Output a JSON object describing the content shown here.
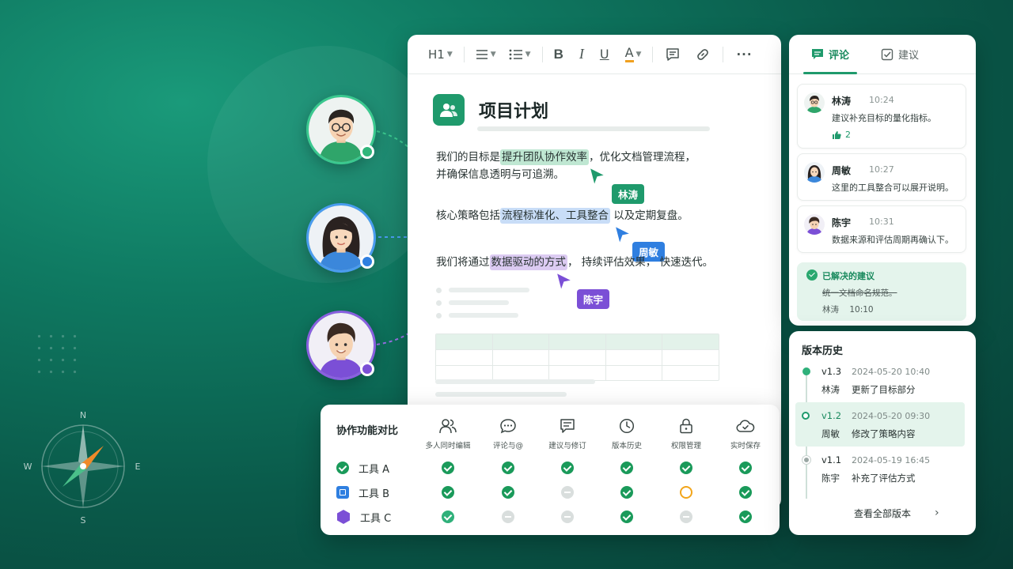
{
  "editor": {
    "toolbar": {
      "heading": "H1",
      "bold": "B",
      "italic": "I",
      "underline": "U",
      "font_color": "A",
      "more": "···"
    },
    "title": "项目计划",
    "paragraphs": [
      {
        "before": "我们的目标是",
        "highlight": "提升团队协作效率",
        "after": "，优化文档管理流程，",
        "line2": "并确保信息透明与可追溯。",
        "cursor_user": "林涛",
        "color": "#1f9a6c"
      },
      {
        "before": "核心策略包括",
        "highlight": "流程标准化、工具整合",
        "after": "以及定期复盘。",
        "cursor_user": "周敏",
        "color": "#2f7fe0"
      },
      {
        "before": "我们将通过",
        "highlight": "数据驱动的方式",
        "after": "，  持续评估效果，  快速迭代。",
        "cursor_user": "陈宇",
        "color": "#7b4fd6"
      }
    ]
  },
  "compare": {
    "title": "协作功能对比",
    "columns": [
      "多人同时编辑",
      "评论与@",
      "建议与修订",
      "版本历史",
      "权限管理",
      "实时保存"
    ],
    "rows": [
      {
        "name": "工具 A",
        "marks": [
          "yes",
          "yes",
          "yes",
          "yes",
          "yes",
          "yes"
        ]
      },
      {
        "name": "工具 B",
        "marks": [
          "yes",
          "yes",
          "no",
          "yes",
          "warn",
          "yes"
        ]
      },
      {
        "name": "工具 C",
        "marks": [
          "partial",
          "no",
          "no",
          "yes",
          "no",
          "yes"
        ]
      }
    ]
  },
  "comments": {
    "tabs": [
      "评论",
      "建议"
    ],
    "items": [
      {
        "name": "林涛",
        "time": "10:24",
        "text": "建议补充目标的量化指标。",
        "likes": "2"
      },
      {
        "name": "周敏",
        "time": "10:27",
        "text": "这里的工具整合可以展开说明。"
      },
      {
        "name": "陈宇",
        "time": "10:31",
        "text": "数据来源和评估周期再确认下。"
      }
    ],
    "resolved": {
      "title": "已解决的建议",
      "text": "统一文档命名规范。",
      "author": "林涛",
      "time": "10:10"
    }
  },
  "history": {
    "title": "版本历史",
    "versions": [
      {
        "version": "v1.3",
        "date": "2024-05-20 10:40",
        "author": "林涛",
        "desc": "更新了目标部分"
      },
      {
        "version": "v1.2",
        "date": "2024-05-20 09:30",
        "author": "周敏",
        "desc": "修改了策略内容"
      },
      {
        "version": "v1.1",
        "date": "2024-05-19 16:45",
        "author": "陈宇",
        "desc": "补充了评估方式"
      }
    ],
    "view_all": "查看全部版本"
  },
  "compass": {
    "n": "N",
    "s": "S",
    "e": "E",
    "w": "W"
  },
  "colors": {
    "green": "#1f9a6c",
    "blue": "#2f7fe0",
    "purple": "#7b4fd6",
    "orange": "#f2a51a"
  }
}
